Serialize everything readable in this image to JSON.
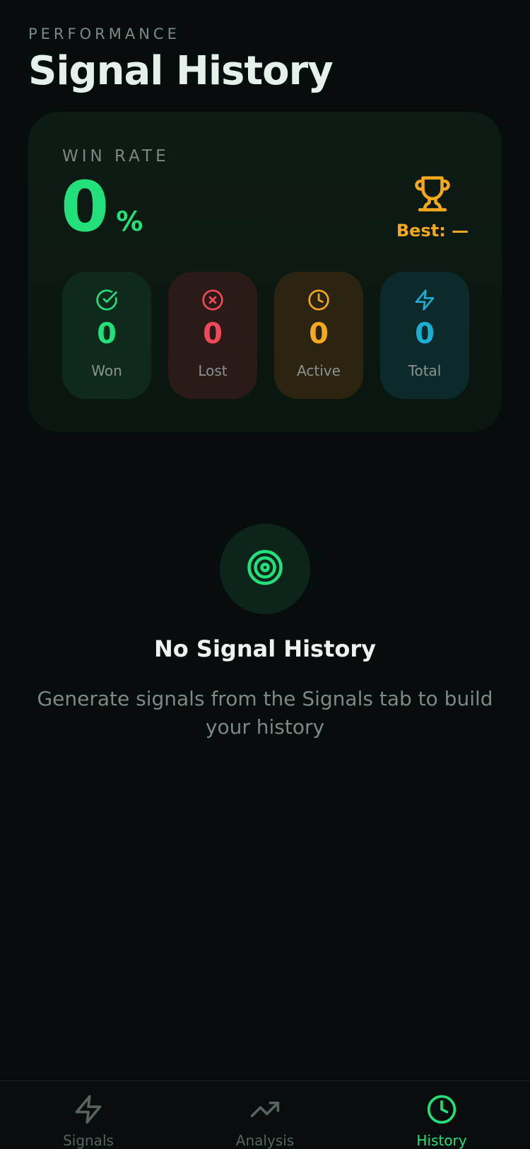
{
  "header": {
    "overline": "PERFORMANCE",
    "title": "Signal History"
  },
  "win_rate": {
    "label": "WIN RATE",
    "value": "0",
    "unit": "%",
    "best": "Best: —"
  },
  "stats": [
    {
      "value": "0",
      "label": "Won",
      "icon": "check-circle-icon",
      "color": "#22e07a"
    },
    {
      "value": "0",
      "label": "Lost",
      "icon": "x-circle-icon",
      "color": "#f04a5a"
    },
    {
      "value": "0",
      "label": "Active",
      "icon": "clock-icon",
      "color": "#f5a81c"
    },
    {
      "value": "0",
      "label": "Total",
      "icon": "lightning-icon",
      "color": "#1ab0d6"
    }
  ],
  "empty_state": {
    "icon": "target-icon",
    "title": "No Signal History",
    "description": "Generate signals from the Signals tab to build your history"
  },
  "tabbar": {
    "tabs": [
      {
        "label": "Signals",
        "icon": "lightning-icon",
        "active": false
      },
      {
        "label": "Analysis",
        "icon": "trending-up-icon",
        "active": false
      },
      {
        "label": "History",
        "icon": "clock-icon",
        "active": true
      }
    ]
  },
  "colors": {
    "accent": "#22e07a",
    "gold": "#f5a81c",
    "background": "#070d0c"
  }
}
